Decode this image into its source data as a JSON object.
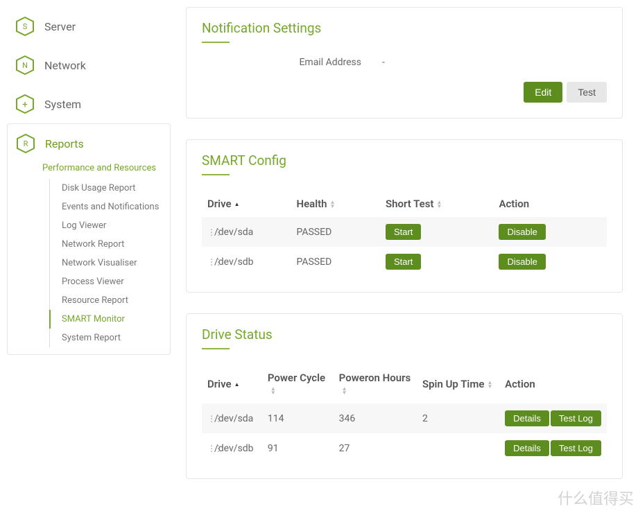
{
  "sidebar": {
    "items": [
      {
        "label": "Server",
        "letter": "S"
      },
      {
        "label": "Network",
        "letter": "N"
      },
      {
        "label": "System",
        "letter": "+"
      },
      {
        "label": "Reports",
        "letter": "R",
        "active": true
      }
    ],
    "subgroup_label": "Performance and Resources",
    "subitems": [
      {
        "label": "Disk Usage Report"
      },
      {
        "label": "Events and Notifications"
      },
      {
        "label": "Log Viewer"
      },
      {
        "label": "Network Report"
      },
      {
        "label": "Network Visualiser"
      },
      {
        "label": "Process Viewer"
      },
      {
        "label": "Resource Report"
      },
      {
        "label": "SMART Monitor",
        "active": true
      },
      {
        "label": "System Report"
      }
    ]
  },
  "notification": {
    "title": "Notification Settings",
    "email_label": "Email Address",
    "email_value": "-",
    "edit_label": "Edit",
    "test_label": "Test"
  },
  "smart_config": {
    "title": "SMART Config",
    "headers": {
      "drive": "Drive",
      "health": "Health",
      "short_test": "Short Test",
      "action": "Action"
    },
    "start_label": "Start",
    "disable_label": "Disable",
    "rows": [
      {
        "drive": "/dev/sda",
        "health": "PASSED"
      },
      {
        "drive": "/dev/sdb",
        "health": "PASSED"
      }
    ]
  },
  "drive_status": {
    "title": "Drive Status",
    "headers": {
      "drive": "Drive",
      "power_cycle": "Power Cycle",
      "poweron_hours": "Poweron Hours",
      "spin_up": "Spin Up Time",
      "action": "Action"
    },
    "details_label": "Details",
    "testlog_label": "Test Log",
    "rows": [
      {
        "drive": "/dev/sda",
        "power_cycle": "114",
        "poweron_hours": "346",
        "spin_up": "2"
      },
      {
        "drive": "/dev/sdb",
        "power_cycle": "91",
        "poweron_hours": "27",
        "spin_up": ""
      }
    ]
  },
  "watermark": "什么值得买"
}
